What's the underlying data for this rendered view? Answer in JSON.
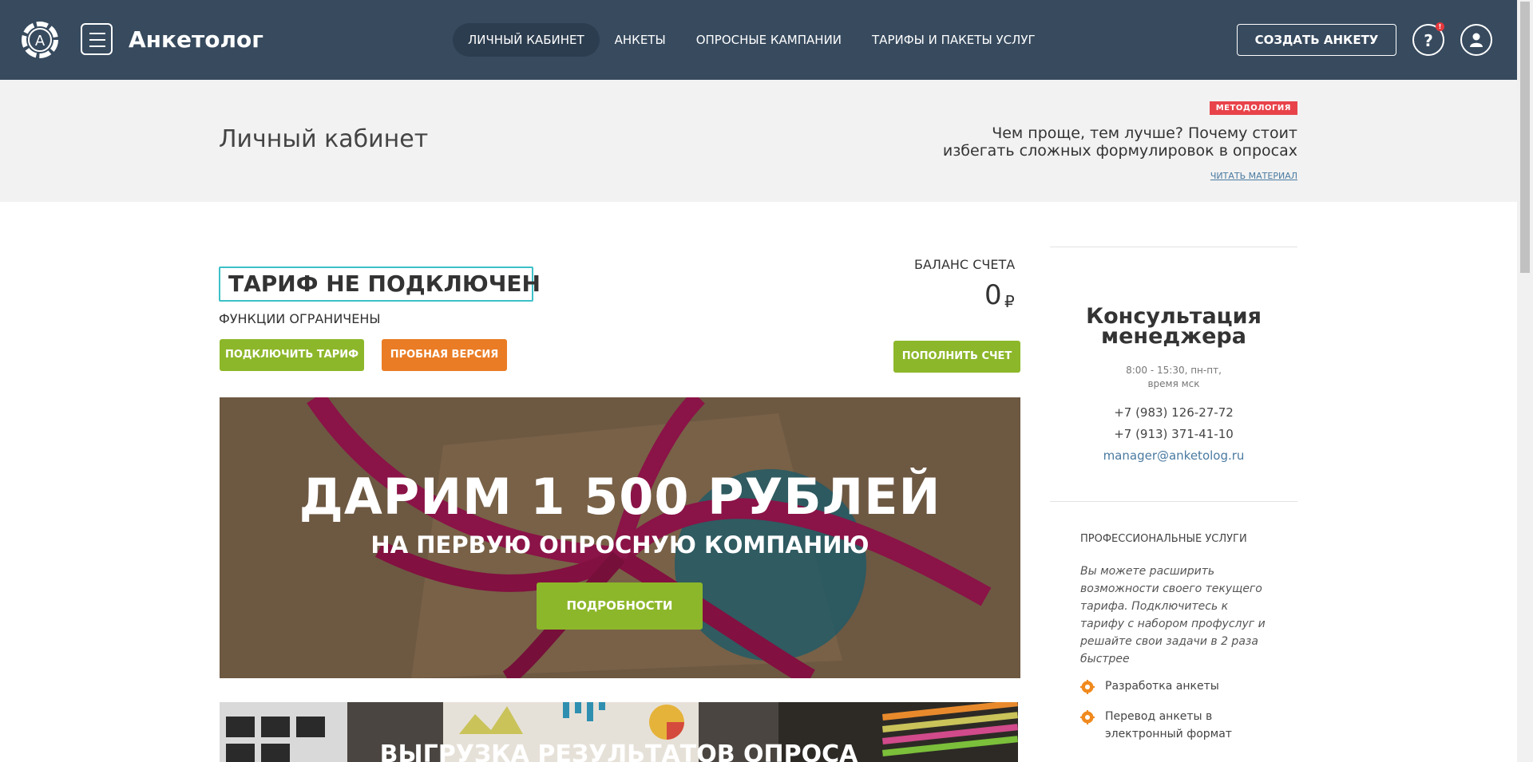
{
  "header": {
    "brand": "Анкетолог",
    "logo_letter": "A",
    "nav": [
      {
        "label": "Личный кабинет",
        "active": true
      },
      {
        "label": "Анкеты",
        "active": false
      },
      {
        "label": "Опросные кампании",
        "active": false
      },
      {
        "label": "Тарифы и пакеты услуг",
        "active": false
      }
    ],
    "create_button": "Создать анкету",
    "help_badge": "!",
    "help_symbol": "?"
  },
  "subheader": {
    "page_title": "Личный кабинет",
    "news_tag": "МЕТОДОЛОГИЯ",
    "news_title": "Чем проще, тем лучше? Почему стоит избегать сложных формулировок в опросах",
    "news_link": "Читать материал"
  },
  "tariff": {
    "status": "ТАРИФ НЕ ПОДКЛЮЧЕН",
    "subtitle": "Функции ограничены",
    "connect_button": "Подключить тариф",
    "trial_button": "Пробная версия"
  },
  "balance": {
    "label": "Баланс счета",
    "value": "0",
    "currency": "₽",
    "topup_button": "Пополнить счет"
  },
  "promo": {
    "title": "ДАРИМ 1 500 РУБЛЕЙ",
    "subtitle": "на первую опросную компанию",
    "button": "Подробности"
  },
  "banner2": {
    "title": "Выгрузка результатов опроса"
  },
  "sidebar": {
    "consult_title": "Консультация менеджера",
    "hours_line1": "8:00 - 15:30, пн-пт,",
    "hours_line2": "время мск",
    "phone1": "+7 (983) 126-27-72",
    "phone2": "+7 (913) 371-41-10",
    "email": "manager@anketolog.ru",
    "pro_title": "Профессиональные услуги",
    "pro_text": "Вы можете расширить возможности своего текущего тарифа. Подключитесь к тарифу с набором профуслуг и решайте свои задачи в 2 раза быстрее",
    "pro_items": [
      "Разработка анкеты",
      "Перевод анкеты в электронный формат"
    ]
  },
  "colors": {
    "header_bg": "#374a5e",
    "green": "#8db72a",
    "orange": "#ea7c25",
    "tag_red": "#e8434a",
    "tariff_border": "#3cc0c8",
    "link": "#4a7aa0"
  }
}
